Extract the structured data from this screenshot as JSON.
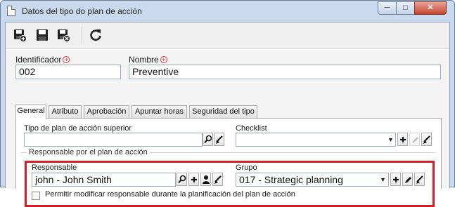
{
  "window": {
    "title": "Datos del tipo do plan de acción",
    "controls": {
      "minimize": "─",
      "maximize": "□",
      "close": "✕"
    }
  },
  "toolbar": {
    "icons": [
      "save-new-icon",
      "save-icon",
      "save-close-icon",
      "refresh-icon"
    ]
  },
  "form": {
    "identificador": {
      "label": "Identificador",
      "value": "002"
    },
    "nombre": {
      "label": "Nombre",
      "value": "Preventive"
    }
  },
  "tabs": [
    {
      "label": "General",
      "active": true
    },
    {
      "label": "Atributo",
      "active": false
    },
    {
      "label": "Aprobación",
      "active": false
    },
    {
      "label": "Apuntar horas",
      "active": false
    },
    {
      "label": "Seguridad del tipo",
      "active": false
    }
  ],
  "general": {
    "tipo_superior": {
      "label": "Tipo de plan de acción superior",
      "value": ""
    },
    "checklist": {
      "label": "Checklist",
      "value": ""
    },
    "responsable_group": {
      "legend": "Responsable por el plan de acción",
      "responsable": {
        "label": "Responsable",
        "value": "john - John Smith"
      },
      "grupo": {
        "label": "Grupo",
        "value": "017 - Strategic planning"
      },
      "permitir": {
        "label": "Permitir modificar responsable durante la planificación del plan de acción",
        "checked": false
      }
    }
  },
  "colors": {
    "highlight": "#d41f26",
    "required": "#d33333",
    "titlebar": "#c9d9ee"
  }
}
